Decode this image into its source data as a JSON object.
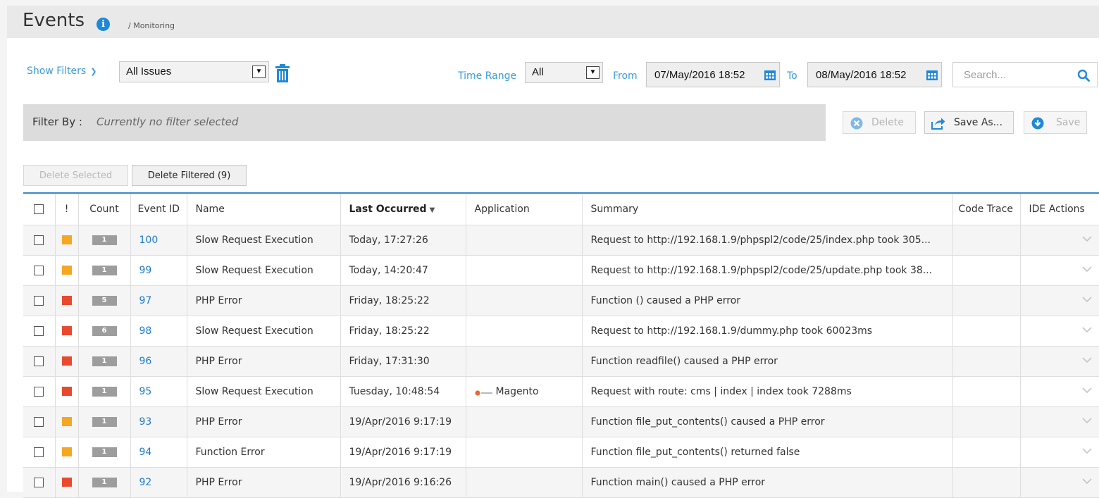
{
  "header": {
    "title": "Events",
    "breadcrumb": "/ Monitoring"
  },
  "toolbar": {
    "show_filters": "Show Filters",
    "issues_select": "All Issues",
    "time_range_label": "Time Range",
    "time_range_value": "All",
    "from_label": "From",
    "from_value": "07/May/2016 18:52",
    "to_label": "To",
    "to_value": "08/May/2016 18:52",
    "search_placeholder": "Search..."
  },
  "filter_bar": {
    "label": "Filter By :",
    "status": "Currently no filter selected",
    "delete": "Delete",
    "save_as": "Save As...",
    "save": "Save"
  },
  "actions": {
    "delete_selected": "Delete Selected",
    "delete_filtered": "Delete Filtered (9)"
  },
  "colors": {
    "accent": "#3a9ad9",
    "link": "#1e7bd0",
    "severity_warning": "#f5a623",
    "severity_critical": "#e84a2f",
    "count_badge": "#9d9d9d",
    "table_top_border": "#3a87c7"
  },
  "table": {
    "columns": [
      "",
      "!",
      "Count",
      "Event ID",
      "Name",
      "Last Occurred",
      "Application",
      "Summary",
      "Code Trace",
      "IDE Actions"
    ],
    "sorted_column": "Last Occurred",
    "rows": [
      {
        "severity": "warning",
        "severity_color": "#f5a623",
        "count": "1",
        "id": "100",
        "name": "Slow Request Execution",
        "last": "Today, 17:27:26",
        "app": "",
        "summary": "Request to http://192.168.1.9/phpspl2/code/25/index.php took 305..."
      },
      {
        "severity": "warning",
        "severity_color": "#f5a623",
        "count": "1",
        "id": "99",
        "name": "Slow Request Execution",
        "last": "Today, 14:20:47",
        "app": "",
        "summary": "Request to http://192.168.1.9/phpspl2/code/25/update.php took 38..."
      },
      {
        "severity": "critical",
        "severity_color": "#e84a2f",
        "count": "5",
        "id": "97",
        "name": "PHP Error",
        "last": "Friday, 18:25:22",
        "app": "",
        "summary": "Function () caused a PHP error"
      },
      {
        "severity": "critical",
        "severity_color": "#e84a2f",
        "count": "6",
        "id": "98",
        "name": "Slow Request Execution",
        "last": "Friday, 18:25:22",
        "app": "",
        "summary": "Request to http://192.168.1.9/dummy.php took 60023ms"
      },
      {
        "severity": "critical",
        "severity_color": "#e84a2f",
        "count": "1",
        "id": "96",
        "name": "PHP Error",
        "last": "Friday, 17:31:30",
        "app": "",
        "summary": "Function readfile() caused a PHP error"
      },
      {
        "severity": "critical",
        "severity_color": "#e84a2f",
        "count": "1",
        "id": "95",
        "name": "Slow Request Execution",
        "last": "Tuesday, 10:48:54",
        "app": "Magento",
        "summary": "Request with route: cms | index | index took 7288ms"
      },
      {
        "severity": "warning",
        "severity_color": "#f5a623",
        "count": "1",
        "id": "93",
        "name": "PHP Error",
        "last": "19/Apr/2016 9:17:19",
        "app": "",
        "summary": "Function file_put_contents() caused a PHP error"
      },
      {
        "severity": "warning",
        "severity_color": "#f5a623",
        "count": "1",
        "id": "94",
        "name": "Function Error",
        "last": "19/Apr/2016 9:17:19",
        "app": "",
        "summary": "Function file_put_contents() returned false"
      },
      {
        "severity": "critical",
        "severity_color": "#e84a2f",
        "count": "1",
        "id": "92",
        "name": "PHP Error",
        "last": "19/Apr/2016 9:16:26",
        "app": "",
        "summary": "Function main() caused a PHP error"
      }
    ]
  }
}
